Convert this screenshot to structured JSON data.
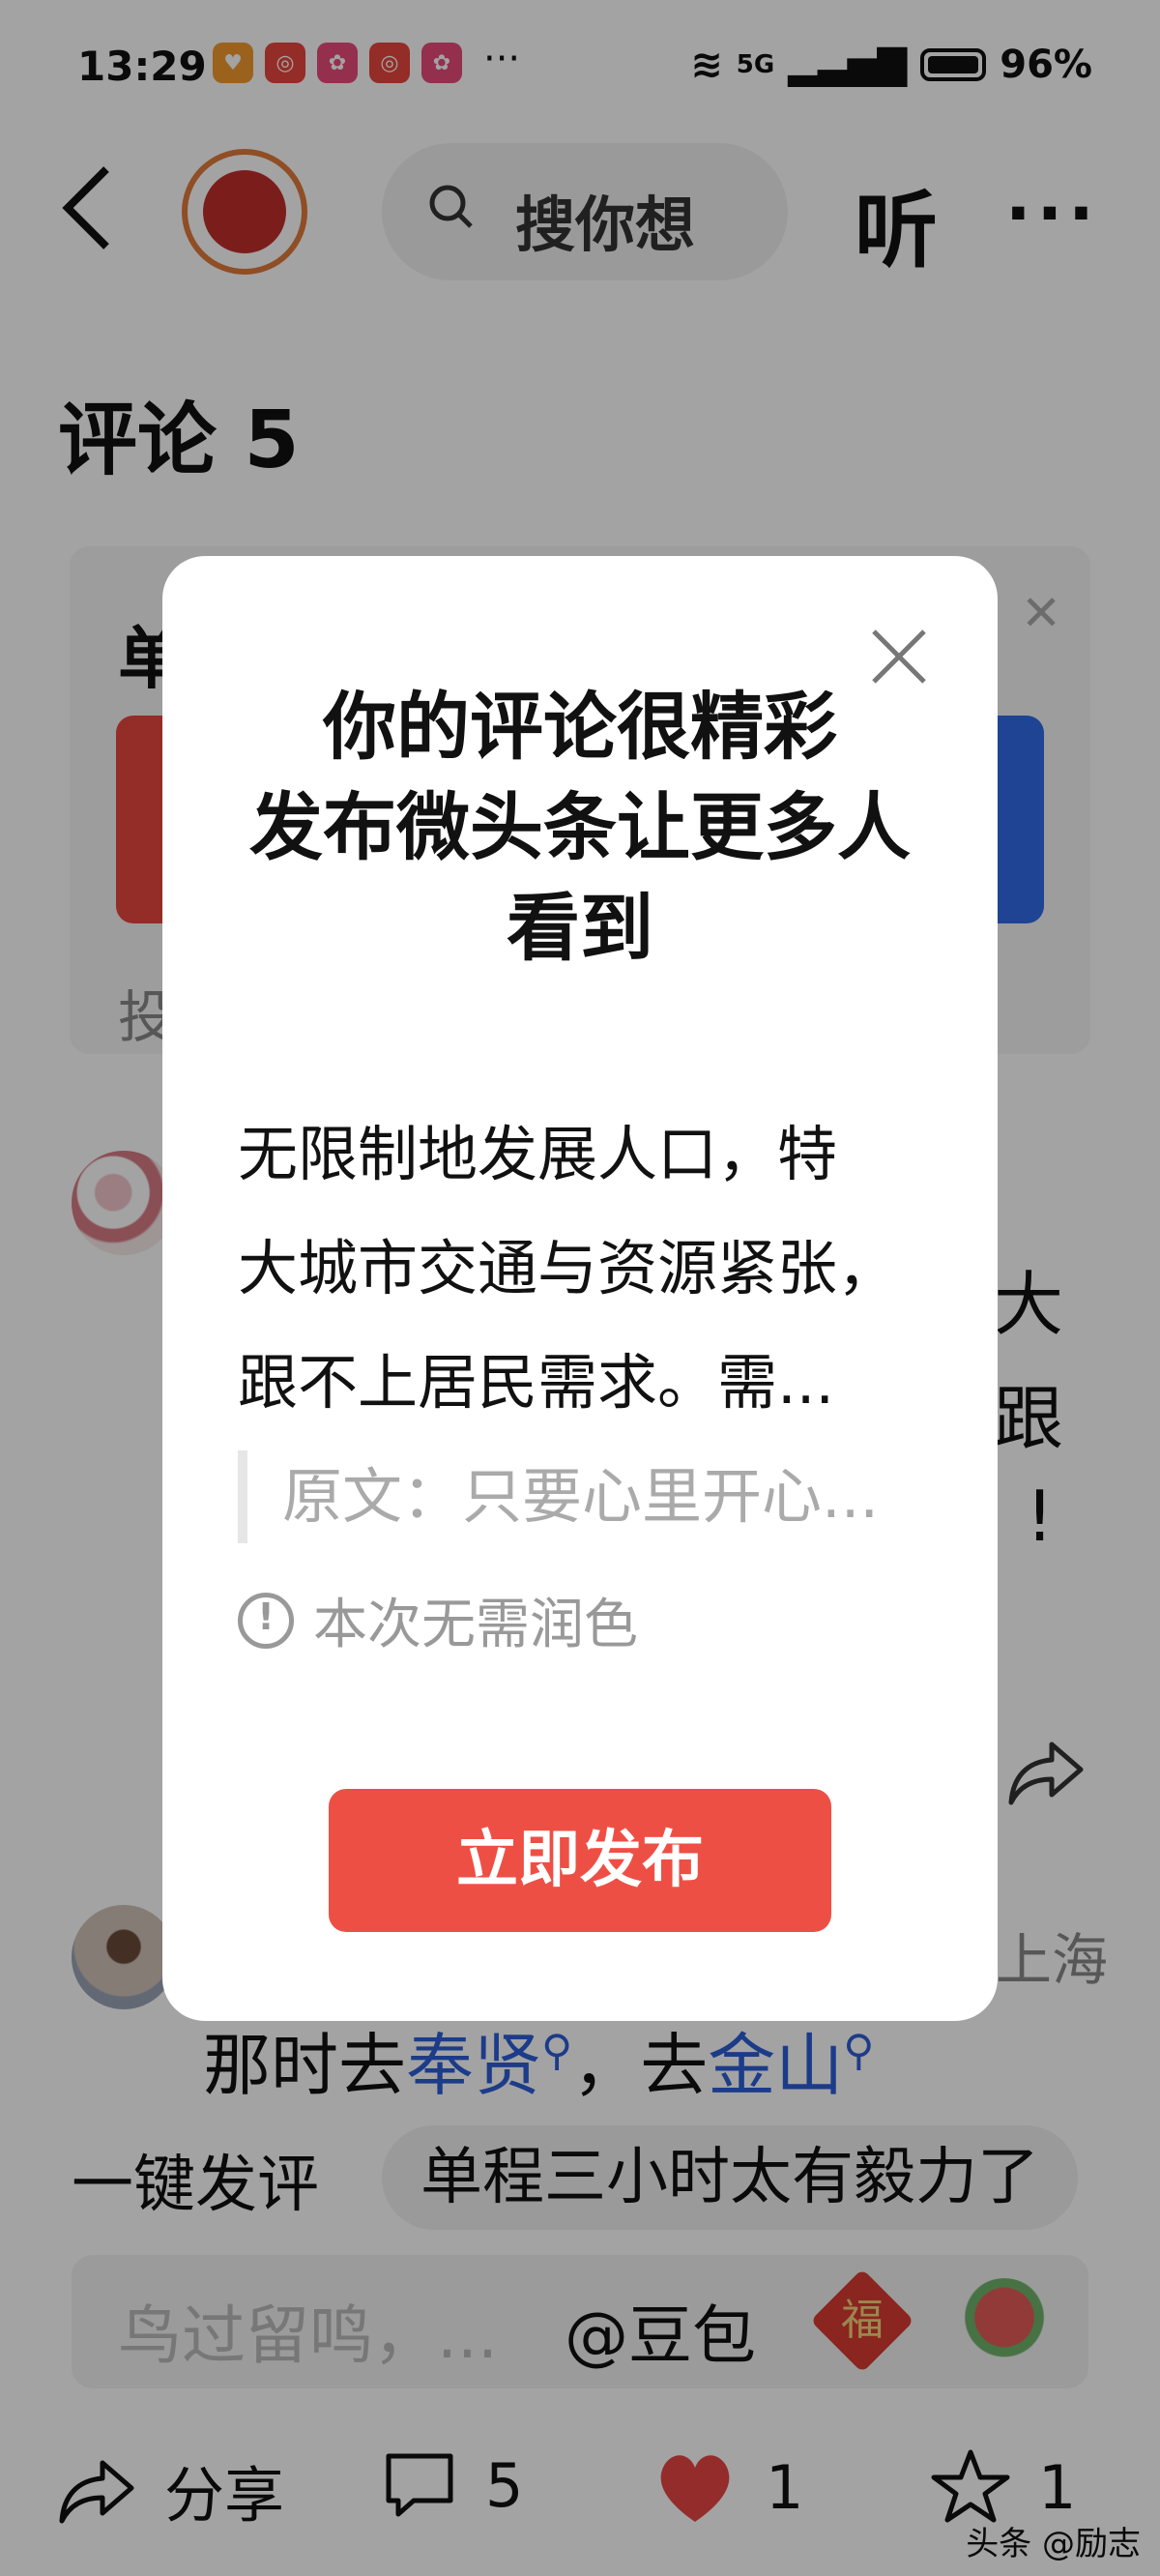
{
  "status_bar": {
    "time": "13:29",
    "network": "5G",
    "battery": "96%"
  },
  "nav": {
    "search_placeholder": "搜你想",
    "listen_label": "听",
    "more_label": "···"
  },
  "page_title": "评论 5",
  "background_card": {
    "title": "单",
    "footer": "投"
  },
  "comment1": {
    "line1": "大",
    "line2": "跟",
    "line3": "!"
  },
  "comment2": {
    "location": "上海",
    "text_prefix": "那时去",
    "link1": "奉贤",
    "sep": "，去",
    "link2": "金山"
  },
  "quick_reply": {
    "label": "一键发评",
    "chip": "单程三小时太有毅力了"
  },
  "input": {
    "placeholder": "鸟过留鸣，...",
    "mention": "@豆包",
    "fu_char": "福"
  },
  "bottom_bar": {
    "share_label": "分享",
    "comment_count": "5",
    "like_count": "1",
    "favorite_count": "1",
    "watermark": "头条 @励志"
  },
  "dialog": {
    "title_line1": "你的评论很精彩",
    "title_line2": "发布微头条让更多人",
    "title_line3": "看到",
    "body_line1": "无限制地发展人口，特",
    "body_line2": "大城市交通与资源紧张，",
    "body_line3": "跟不上居民需求。需...",
    "quote": "原文：只要心里开心...",
    "notice": "本次无需润色",
    "publish_button": "立即发布"
  },
  "colors": {
    "accent_red": "#ee4f45",
    "link_blue": "#2d5fd6"
  }
}
